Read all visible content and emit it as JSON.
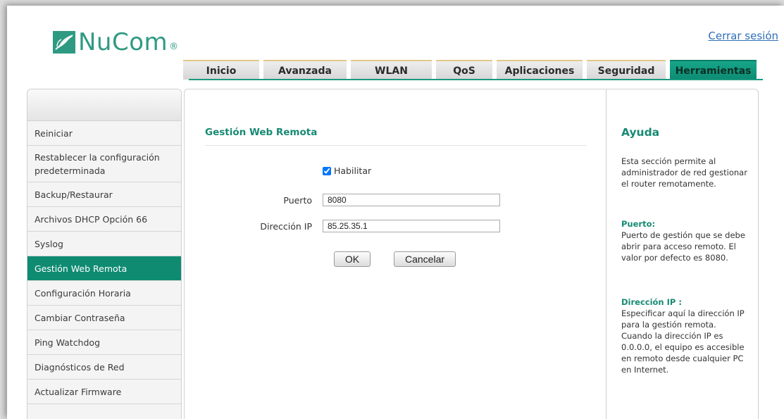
{
  "brand": {
    "name": "NuCom",
    "registered": "®",
    "color": "#2e9a82"
  },
  "logout_label": "Cerrar sesión",
  "tabs": [
    {
      "label": "Inicio",
      "active": false
    },
    {
      "label": "Avanzada",
      "active": false
    },
    {
      "label": "WLAN",
      "active": false
    },
    {
      "label": "QoS",
      "active": false
    },
    {
      "label": "Aplicaciones",
      "active": false
    },
    {
      "label": "Seguridad",
      "active": false
    },
    {
      "label": "Herramientas",
      "active": true
    }
  ],
  "sidebar": {
    "items": [
      {
        "label": "Reiniciar"
      },
      {
        "label": "Restablecer la configuración predeterminada"
      },
      {
        "label": "Backup/Restaurar"
      },
      {
        "label": "Archivos DHCP Opción 66"
      },
      {
        "label": "Syslog"
      },
      {
        "label": "Gestión Web Remota",
        "active": true
      },
      {
        "label": "Configuración Horaria"
      },
      {
        "label": "Cambiar Contraseña"
      },
      {
        "label": "Ping Watchdog"
      },
      {
        "label": "Diagnósticos de Red"
      },
      {
        "label": "Actualizar Firmware"
      }
    ]
  },
  "form": {
    "title": "Gestión Web Remota",
    "enable_label": "Habilitar",
    "enable_checked": true,
    "port_label": "Puerto",
    "port_value": "8080",
    "ip_label": "Dirección IP",
    "ip_value": "85.25.35.1",
    "ok_label": "OK",
    "cancel_label": "Cancelar"
  },
  "help": {
    "title": "Ayuda",
    "intro": "Esta sección permite al administrador de red gestionar el router remotamente.",
    "port_title": "Puerto:",
    "port_text": "Puerto de gestión que se debe abrir para acceso remoto. El valor por defecto es 8080.",
    "ip_title": "Dirección IP :",
    "ip_text": "Especificar aquí la dirección IP para la gestión remota. Cuando la dirección IP es 0.0.0.0, el equipo es accesible en remoto desde cualquier PC en Internet."
  },
  "colors": {
    "accent": "#0f8b72",
    "tab_border": "#e3c98a",
    "link": "#2f6fb7"
  }
}
